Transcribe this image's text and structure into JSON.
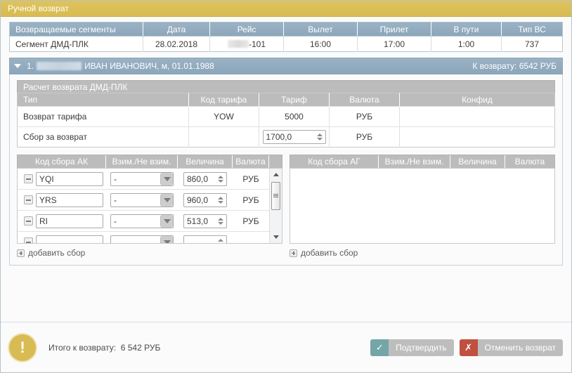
{
  "window": {
    "title": "Ручной возврат"
  },
  "segments_table": {
    "headers": [
      "Возвращаемые сегменты",
      "Дата",
      "Рейс",
      "Вылет",
      "Прилет",
      "В пути",
      "Тип ВС"
    ],
    "rows": [
      {
        "segment": "Сегмент ДМД-ПЛК",
        "date": "28.02.2018",
        "flight": "-101",
        "departure": "16:00",
        "arrival": "17:00",
        "duration": "1:00",
        "aircraft": "737"
      }
    ]
  },
  "passenger": {
    "index": "1.",
    "name": "ИВАН ИВАНОВИЧ, м, 01.01.1988",
    "refund_label": "К возврату: 6542 РУБ",
    "expand_icon": "chevron-down-icon"
  },
  "calculation": {
    "caption": "Расчет возврата ДМД-ПЛК",
    "headers": [
      "Тип",
      "Код тарифа",
      "Тариф",
      "Валюта",
      "Конфид"
    ],
    "rows": [
      {
        "type": "Возврат тарифа",
        "fare_code": "YOW",
        "fare": "5000",
        "currency": "РУБ",
        "confid": ""
      },
      {
        "type": "Сбор за возврат",
        "fare_code": "",
        "fare": "1700,0",
        "currency": "РУБ",
        "confid": ""
      }
    ]
  },
  "fees_ak": {
    "headers": [
      "Код сбора АК",
      "Взим./Не взим.",
      "Величина",
      "Валюта"
    ],
    "rows": [
      {
        "code": "YQI",
        "charge": "-",
        "value": "860,0",
        "currency": "РУБ"
      },
      {
        "code": "YRS",
        "charge": "-",
        "value": "960,0",
        "currency": "РУБ"
      },
      {
        "code": "RI",
        "charge": "-",
        "value": "513,0",
        "currency": "РУБ"
      },
      {
        "code": "",
        "charge": "",
        "value": "",
        "currency": ""
      }
    ],
    "add_label": "добавить сбор",
    "scrollbar": true
  },
  "fees_ag": {
    "headers": [
      "Код сбора АГ",
      "Взим./Не взим.",
      "Величина",
      "Валюта"
    ],
    "rows": [],
    "add_label": "добавить сбор"
  },
  "footer": {
    "warning_icon": "exclamation-icon",
    "total_label": "Итого к возврату:",
    "total_value": "6 542 РУБ",
    "confirm_button": {
      "label": "Подтвердить",
      "icon": "check-icon"
    },
    "cancel_button": {
      "label": "Отменить возврат",
      "icon": "cross-icon"
    }
  },
  "colors": {
    "title_bar": "#d8bb53",
    "table_header": "#8ba5ba",
    "sub_header": "#bcbcbc",
    "confirm_accent": "#74a6a8",
    "cancel_accent": "#c0503f",
    "warning": "#d8bb53"
  }
}
